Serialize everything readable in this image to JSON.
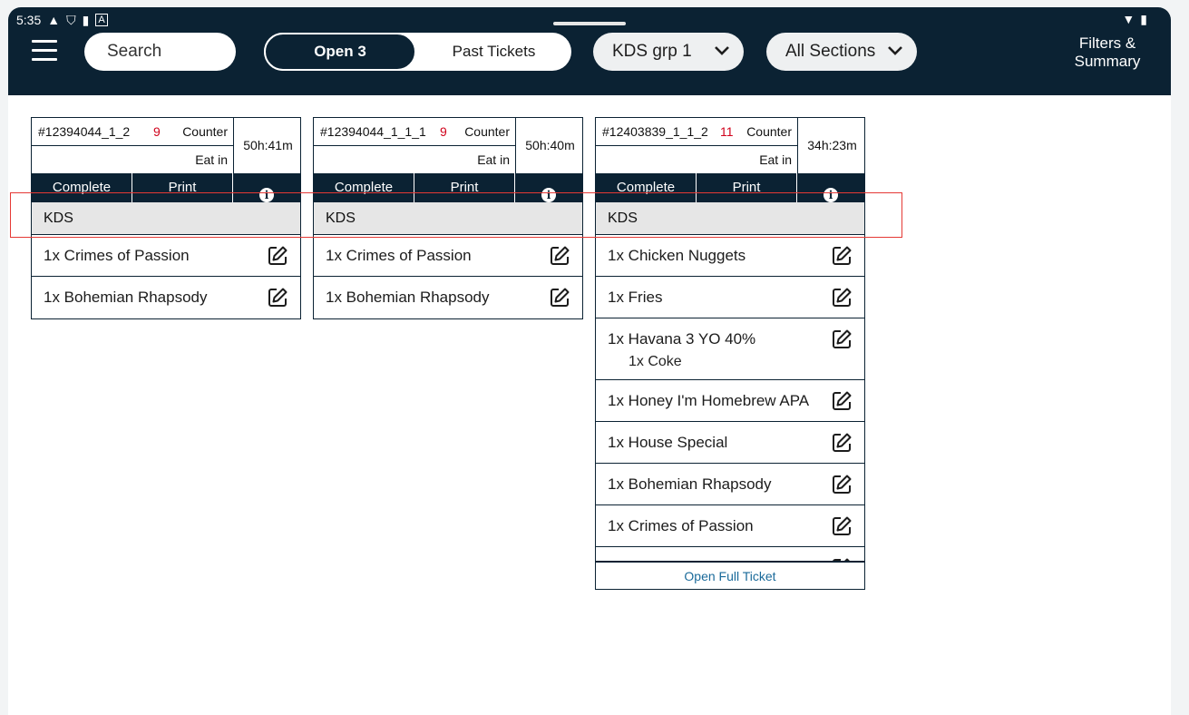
{
  "status_bar": {
    "time": "5:35"
  },
  "appbar": {
    "search_placeholder": "Search",
    "segment": {
      "open_label": "Open 3",
      "past_label": "Past Tickets"
    },
    "group_dropdown": "KDS grp 1",
    "sections_dropdown": "All Sections",
    "filters_line1": "Filters &",
    "filters_line2": "Summary"
  },
  "colors": {
    "appbar": "#0b2233",
    "item_count": "#d0021b",
    "link": "#1a6a9a",
    "highlight": "#e53935"
  },
  "tickets": [
    {
      "id": "#12394044_1_2",
      "count": "9",
      "type": "Counter",
      "service": "Eat in",
      "elapsed": "50h:41m",
      "complete_label": "Complete",
      "print_label": "Print",
      "section": "KDS",
      "items": [
        "1x Crimes of Passion",
        "1x Bohemian Rhapsody"
      ]
    },
    {
      "id": "#12394044_1_1_1",
      "count": "9",
      "type": "Counter",
      "service": "Eat in",
      "elapsed": "50h:40m",
      "complete_label": "Complete",
      "print_label": "Print",
      "section": "KDS",
      "items": [
        "1x Crimes of Passion",
        "1x Bohemian Rhapsody"
      ]
    },
    {
      "id": "#12403839_1_1_2",
      "count": "11",
      "type": "Counter",
      "service": "Eat in",
      "elapsed": "34h:23m",
      "complete_label": "Complete",
      "print_label": "Print",
      "section": "KDS",
      "items": [
        "1x Chicken Nuggets",
        "1x Fries",
        "1x Havana 3 YO 40%",
        "1x Honey I'm Homebrew APA",
        "1x House Special",
        "1x Bohemian Rhapsody",
        "1x Crimes of Passion"
      ],
      "modifier": "1x Coke",
      "open_full_label": "Open Full Ticket"
    }
  ]
}
